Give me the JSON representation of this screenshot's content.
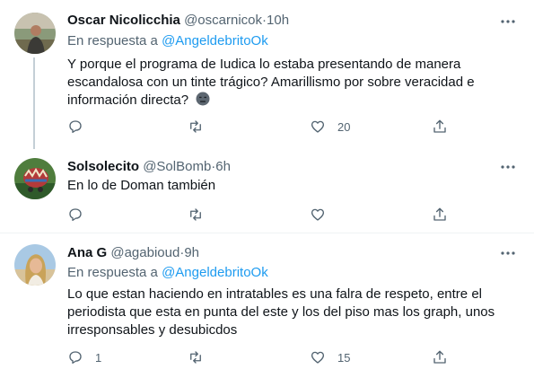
{
  "tweets": [
    {
      "name": "Oscar Nicolicchia",
      "handle": "@oscarnicok",
      "separator": "·",
      "time": "10h",
      "reply_prefix": "En respuesta a ",
      "reply_mention": "@AngeldebritoOk",
      "text": "Y porque el programa de Iudica lo estaba presentando de manera escandalosa con un tinte trágico? Amarillismo por sobre veracidad e información directa?",
      "emoji": "expressionless-face-emoji",
      "replies": "",
      "retweets": "",
      "likes": "20"
    },
    {
      "name": "Solsolecito",
      "handle": "@SolBomb",
      "separator": "·",
      "time": "6h",
      "text": "En lo de Doman también",
      "replies": "",
      "retweets": "",
      "likes": ""
    },
    {
      "name": "Ana G",
      "handle": "@agabioud",
      "separator": "·",
      "time": "9h",
      "reply_prefix": "En respuesta a ",
      "reply_mention": "@AngeldebritoOk",
      "text": "Lo que estan haciendo en intratables es una falra de respeto, entre el periodista que esta en punta del este y los del piso mas los graph, unos irresponsables y desubicdos",
      "replies": "1",
      "retweets": "",
      "likes": "15"
    }
  ],
  "icons": {
    "more": "more-horizontal-icon",
    "reply": "reply-icon",
    "retweet": "retweet-icon",
    "like": "heart-icon",
    "share": "share-icon"
  },
  "colors": {
    "accent": "#1d9bf0",
    "secondary_text": "#536471",
    "primary_text": "#0f1419",
    "divider": "#eff3f4"
  }
}
